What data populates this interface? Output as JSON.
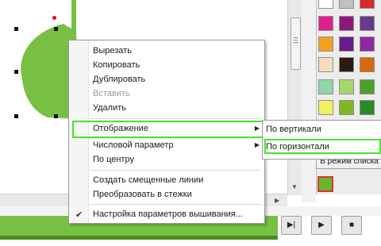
{
  "context_menu": {
    "items": [
      {
        "label": "Вырезать"
      },
      {
        "label": "Копировать"
      },
      {
        "label": "Дублировать"
      },
      {
        "label": "Вставить"
      },
      {
        "label": "Удалить"
      },
      {
        "label": "Отображение"
      },
      {
        "label": "Числовой параметр"
      },
      {
        "label": "По центру"
      },
      {
        "label": "Создать смещенные линии"
      },
      {
        "label": "Преобразовать в стежки"
      },
      {
        "label": "Настройка параметров вышивания..."
      }
    ]
  },
  "submenu": {
    "items": [
      {
        "label": "По вертикали"
      },
      {
        "label": "По горизонтали"
      }
    ]
  },
  "panel": {
    "list_mode_button": "В режим списка"
  },
  "colors": {
    "highlight": "#46e62c",
    "shape_green": "#78c043",
    "palette": [
      "#ffffff",
      "#8a1a7a",
      "#e0208a",
      "#f2a21f",
      "#6a1a8a",
      "#8a2aa0",
      "#f2a83a",
      "#d66a10",
      "#6a3a8a",
      "#f8dcc0",
      "#2a1a10",
      "#e06a10",
      "#90d6a8",
      "#a8d66a",
      "#4ea02a",
      "#f0f060",
      "#80b820",
      "#2a8a2a"
    ]
  },
  "icons": [
    "check-icon",
    "submenu-arrow-icon",
    "play-icon",
    "step-icon",
    "stop-icon"
  ]
}
